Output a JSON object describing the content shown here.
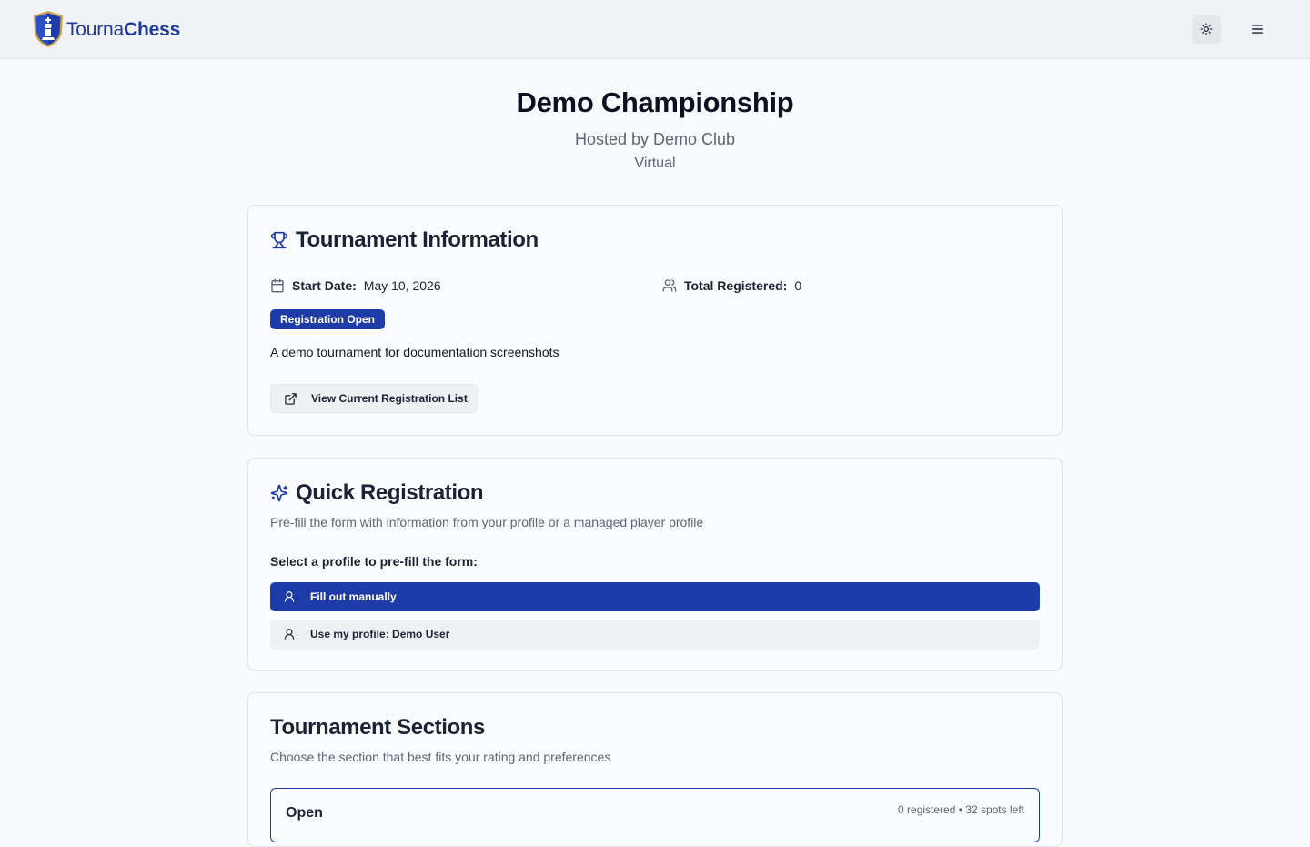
{
  "header": {
    "logo_part1": "Tourna",
    "logo_part2": "Chess"
  },
  "hero": {
    "title": "Demo Championship",
    "hosted_by": "Hosted by Demo Club",
    "location": "Virtual"
  },
  "tournament_info": {
    "title": "Tournament Information",
    "start_date_label": "Start Date:",
    "start_date_value": "May 10, 2026",
    "total_registered_label": "Total Registered:",
    "total_registered_value": "0",
    "status_badge": "Registration Open",
    "description": "A demo tournament for documentation screenshots",
    "view_list_button": "View Current Registration List"
  },
  "quick_registration": {
    "title": "Quick Registration",
    "subtitle": "Pre-fill the form with information from your profile or a managed player profile",
    "select_label": "Select a profile to pre-fill the form:",
    "options": [
      {
        "label": "Fill out manually",
        "selected": true
      },
      {
        "label": "Use my profile: Demo User",
        "selected": false
      }
    ]
  },
  "sections": {
    "title": "Tournament Sections",
    "subtitle": "Choose the section that best fits your rating and preferences",
    "items": [
      {
        "name": "Open",
        "registered": "0 registered",
        "spots": "32 spots left"
      }
    ]
  },
  "colors": {
    "brand": "#1e3ca8",
    "background": "#f9fafb",
    "header_bg": "#f1f2f5",
    "muted_text": "#5b6575"
  },
  "icons": {
    "logo": "shield-king-icon",
    "theme": "sun-icon",
    "menu": "hamburger-icon",
    "tournament_info": "trophy-icon",
    "start_date": "calendar-icon",
    "total_registered": "users-icon",
    "view_list": "external-link-icon",
    "quick_registration": "sparkles-icon",
    "profile_option": "user-icon"
  }
}
